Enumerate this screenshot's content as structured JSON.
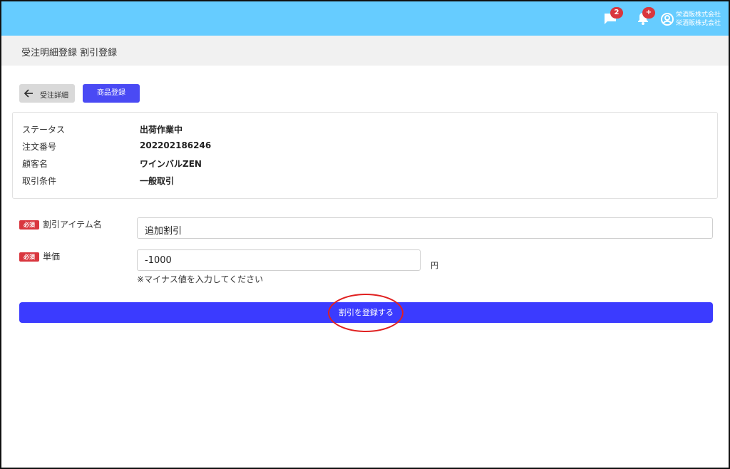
{
  "header": {
    "message_badge": "2",
    "notification_badge": "+",
    "user_line1": "栄酒販株式会社",
    "user_line2": "栄酒販株式会社"
  },
  "page_title": "受注明細登録 割引登録",
  "actions": {
    "back_label": "受注詳細",
    "product_register_label": "商品登録"
  },
  "order_info": [
    {
      "label": "ステータス",
      "value": "出荷作業中"
    },
    {
      "label": "注文番号",
      "value": "202202186246"
    },
    {
      "label": "顧客名",
      "value": "ワインバルZEN"
    },
    {
      "label": "取引条件",
      "value": "一般取引"
    }
  ],
  "form": {
    "required_badge": "必須",
    "item_name_label": "割引アイテム名",
    "item_name_value": "追加割引",
    "price_label": "単価",
    "price_value": "-1000",
    "price_unit": "円",
    "price_hint": "※マイナス値を入力してください",
    "submit_label": "割引を登録する"
  },
  "colors": {
    "header_bg": "#66ccff",
    "primary": "#3b3bff",
    "required": "#d9363e",
    "highlight_circle": "#e02020"
  }
}
